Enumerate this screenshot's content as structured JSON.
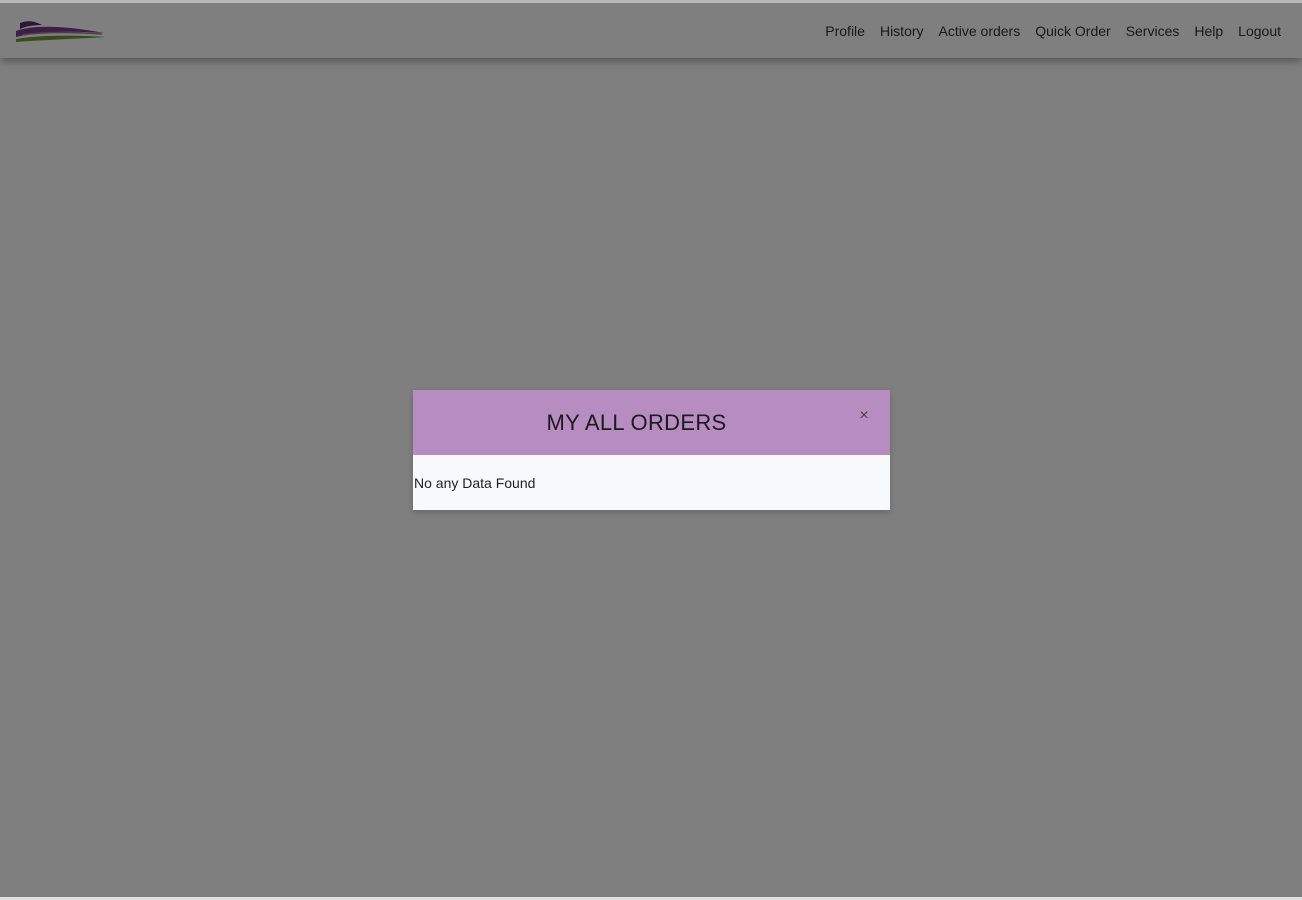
{
  "navbar": {
    "logo_icon": "brand-logo",
    "links": [
      "Profile",
      "History",
      "Active orders",
      "Quick Order",
      "Services",
      "Help",
      "Logout"
    ]
  },
  "modal": {
    "title": "MY ALL ORDERS",
    "close_icon": "close-icon",
    "close_glyph": "×",
    "empty_message": "No any Data Found"
  },
  "colors": {
    "modal_header": "#b78cc1",
    "modal_body": "#f7f9fb",
    "backdrop": "rgba(0,0,0,0.5)"
  }
}
